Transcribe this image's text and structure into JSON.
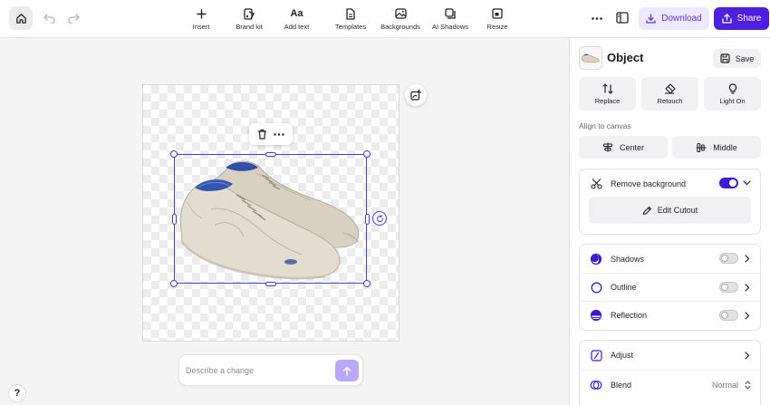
{
  "toolbar": {
    "tools": [
      {
        "label": "Insert",
        "icon": "plus-icon"
      },
      {
        "label": "Brand kit",
        "icon": "brand-kit-icon"
      },
      {
        "label": "Add text",
        "icon": "text-icon"
      },
      {
        "label": "Templates",
        "icon": "templates-icon"
      },
      {
        "label": "Backgrounds",
        "icon": "backgrounds-icon"
      },
      {
        "label": "AI Shadows",
        "icon": "ai-shadows-icon"
      },
      {
        "label": "Resize",
        "icon": "resize-icon"
      }
    ],
    "download_label": "Download",
    "share_label": "Share"
  },
  "canvas": {
    "prompt_placeholder": "Describe a change",
    "help_label": "?"
  },
  "panel": {
    "title": "Object",
    "save_label": "Save",
    "actions": [
      {
        "label": "Replace",
        "icon": "replace-icon"
      },
      {
        "label": "Retouch",
        "icon": "retouch-icon"
      },
      {
        "label": "Light On",
        "icon": "bulb-icon"
      }
    ],
    "align_label": "Align to canvas",
    "align_center_label": "Center",
    "align_middle_label": "Middle",
    "remove_bg_label": "Remove background",
    "remove_bg_on": true,
    "edit_cutout_label": "Edit Cutout",
    "effects": [
      {
        "label": "Shadows",
        "icon": "shadows-icon",
        "on": false
      },
      {
        "label": "Outline",
        "icon": "outline-icon",
        "on": false
      },
      {
        "label": "Reflection",
        "icon": "reflection-icon",
        "on": false
      }
    ],
    "adjust_label": "Adjust",
    "blend_label": "Blend",
    "blend_value": "Normal"
  },
  "colors": {
    "accent": "#4f1fe0",
    "accent_light": "#ede8ff",
    "selection": "#4a3bd6"
  }
}
